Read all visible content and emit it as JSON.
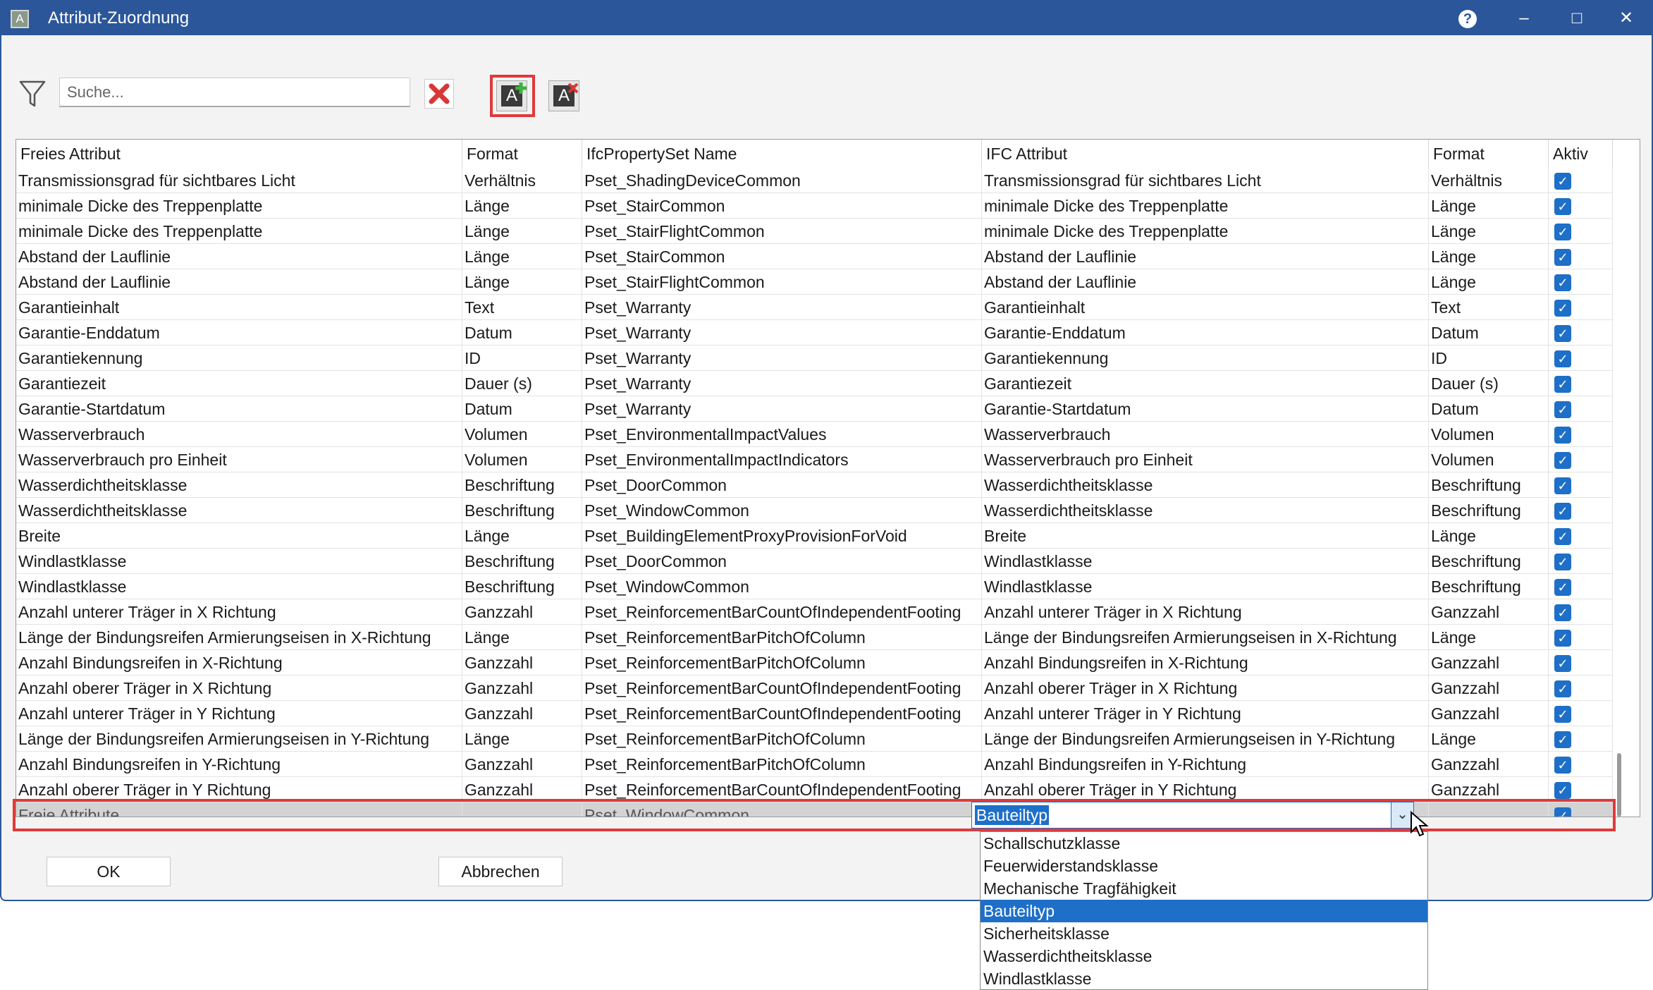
{
  "window": {
    "title": "Attribut-Zuordnung",
    "app_icon": "A",
    "help": "?",
    "minimize": "–",
    "maximize": "□",
    "close": "✕"
  },
  "toolbar": {
    "search_placeholder": "Suche...",
    "add_icon": "A",
    "delete_icon": "A"
  },
  "table": {
    "columns": [
      "Freies Attribut",
      "Format",
      "IfcPropertySet Name",
      "IFC Attribut",
      "Format",
      "Aktiv"
    ],
    "rows": [
      [
        "Transmissionsgrad für sichtbares Licht",
        "Verhältnis",
        "Pset_ShadingDeviceCommon",
        "Transmissionsgrad für sichtbares Licht",
        "Verhältnis"
      ],
      [
        "minimale Dicke des Treppenplatte",
        "Länge",
        "Pset_StairCommon",
        "minimale Dicke des Treppenplatte",
        "Länge"
      ],
      [
        "minimale Dicke des Treppenplatte",
        "Länge",
        "Pset_StairFlightCommon",
        "minimale Dicke des Treppenplatte",
        "Länge"
      ],
      [
        "Abstand der Lauflinie",
        "Länge",
        "Pset_StairCommon",
        "Abstand der Lauflinie",
        "Länge"
      ],
      [
        "Abstand der Lauflinie",
        "Länge",
        "Pset_StairFlightCommon",
        "Abstand der Lauflinie",
        "Länge"
      ],
      [
        "Garantieinhalt",
        "Text",
        "Pset_Warranty",
        "Garantieinhalt",
        "Text"
      ],
      [
        "Garantie-Enddatum",
        "Datum",
        "Pset_Warranty",
        "Garantie-Enddatum",
        "Datum"
      ],
      [
        "Garantiekennung",
        "ID",
        "Pset_Warranty",
        "Garantiekennung",
        "ID"
      ],
      [
        "Garantiezeit",
        "Dauer (s)",
        "Pset_Warranty",
        "Garantiezeit",
        "Dauer (s)"
      ],
      [
        "Garantie-Startdatum",
        "Datum",
        "Pset_Warranty",
        "Garantie-Startdatum",
        "Datum"
      ],
      [
        "Wasserverbrauch",
        "Volumen",
        "Pset_EnvironmentalImpactValues",
        "Wasserverbrauch",
        "Volumen"
      ],
      [
        "Wasserverbrauch pro Einheit",
        "Volumen",
        "Pset_EnvironmentalImpactIndicators",
        "Wasserverbrauch pro Einheit",
        "Volumen"
      ],
      [
        "Wasserdichtheitsklasse",
        "Beschriftung",
        "Pset_DoorCommon",
        "Wasserdichtheitsklasse",
        "Beschriftung"
      ],
      [
        "Wasserdichtheitsklasse",
        "Beschriftung",
        "Pset_WindowCommon",
        "Wasserdichtheitsklasse",
        "Beschriftung"
      ],
      [
        "Breite",
        "Länge",
        "Pset_BuildingElementProxyProvisionForVoid",
        "Breite",
        "Länge"
      ],
      [
        "Windlastklasse",
        "Beschriftung",
        "Pset_DoorCommon",
        "Windlastklasse",
        "Beschriftung"
      ],
      [
        "Windlastklasse",
        "Beschriftung",
        "Pset_WindowCommon",
        "Windlastklasse",
        "Beschriftung"
      ],
      [
        "Anzahl unterer Träger in X Richtung",
        "Ganzzahl",
        "Pset_ReinforcementBarCountOfIndependentFooting",
        "Anzahl unterer Träger in X Richtung",
        "Ganzzahl"
      ],
      [
        "Länge der Bindungsreifen Armierungseisen in X-Richtung",
        "Länge",
        "Pset_ReinforcementBarPitchOfColumn",
        "Länge der Bindungsreifen Armierungseisen in X-Richtung",
        "Länge"
      ],
      [
        "Anzahl  Bindungsreifen in X-Richtung",
        "Ganzzahl",
        "Pset_ReinforcementBarPitchOfColumn",
        "Anzahl Bindungsreifen in X-Richtung",
        "Ganzzahl"
      ],
      [
        "Anzahl oberer Träger in X Richtung",
        "Ganzzahl",
        "Pset_ReinforcementBarCountOfIndependentFooting",
        "Anzahl oberer Träger in X Richtung",
        "Ganzzahl"
      ],
      [
        "Anzahl unterer Träger in Y Richtung",
        "Ganzzahl",
        "Pset_ReinforcementBarCountOfIndependentFooting",
        "Anzahl unterer Träger in Y Richtung",
        "Ganzzahl"
      ],
      [
        "Länge der Bindungsreifen Armierungseisen in Y-Richtung",
        "Länge",
        "Pset_ReinforcementBarPitchOfColumn",
        "Länge der Bindungsreifen Armierungseisen in Y-Richtung",
        "Länge"
      ],
      [
        "Anzahl Bindungsreifen in Y-Richtung",
        "Ganzzahl",
        "Pset_ReinforcementBarPitchOfColumn",
        "Anzahl Bindungsreifen in Y-Richtung",
        "Ganzzahl"
      ],
      [
        "Anzahl oberer Träger in Y Richtung",
        "Ganzzahl",
        "Pset_ReinforcementBarCountOfIndependentFooting",
        "Anzahl oberer Träger in Y Richtung",
        "Ganzzahl"
      ]
    ],
    "checked_mark": "✓",
    "editing_row": {
      "free_attribute": "Freie Attribute",
      "format": "",
      "pset": "Pset_WindowCommon",
      "ifc_value": "Bauteiltyp",
      "ifc_format": ""
    }
  },
  "dropdown": {
    "options": [
      "Schallschutzklasse",
      "Feuerwiderstandsklasse",
      "Mechanische Tragfähigkeit",
      "Bauteiltyp",
      "Sicherheitsklasse",
      "Wasserdichtheitsklasse",
      "Windlastklasse"
    ],
    "selected": "Bauteiltyp"
  },
  "buttons": {
    "ok": "OK",
    "cancel": "Abbrechen"
  },
  "colors": {
    "titlebar": "#2b579a",
    "accent": "#1e6fc7",
    "highlight": "#e03a3a"
  }
}
